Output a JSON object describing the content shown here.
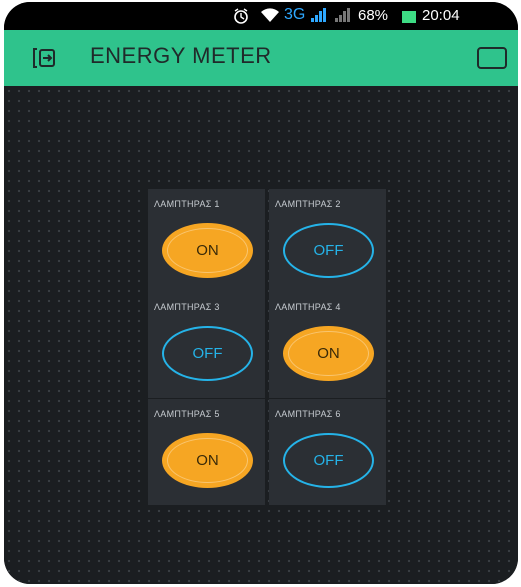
{
  "status_bar": {
    "network": "3G",
    "battery": "68%",
    "time": "20:04"
  },
  "app_bar": {
    "title": "ENERGY METER",
    "exit_icon": "exit-icon",
    "menu_icon": "window-icon"
  },
  "switches": [
    {
      "label": "ΛΑΜΠΤΗΡΑΣ 1",
      "state": "ON"
    },
    {
      "label": "ΛΑΜΠΤΗΡΑΣ 2",
      "state": "OFF"
    },
    {
      "label": "ΛΑΜΠΤΗΡΑΣ 3",
      "state": "OFF"
    },
    {
      "label": "ΛΑΜΠΤΗΡΑΣ 4",
      "state": "ON"
    },
    {
      "label": "ΛΑΜΠΤΗΡΑΣ 5",
      "state": "ON"
    },
    {
      "label": "ΛΑΜΠΤΗΡΑΣ 6",
      "state": "OFF"
    }
  ],
  "colors": {
    "app_bar": "#2fc38c",
    "on": "#f6a623",
    "off": "#25b3e8",
    "background": "#1b1e21",
    "tile": "#2b2f34"
  }
}
